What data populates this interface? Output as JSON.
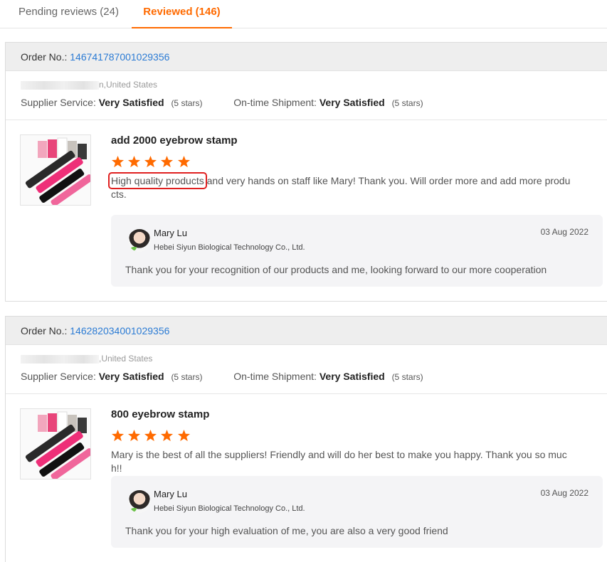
{
  "tabs": [
    {
      "label": "Pending reviews (24)"
    },
    {
      "label": "Reviewed (146)",
      "active": true
    }
  ],
  "colors": {
    "accent": "#ff6a00",
    "link": "#2b7bd4",
    "highlight_box": "#e02020"
  },
  "reviews": [
    {
      "order_label": "Order No.:",
      "order_no": "146741787001029356",
      "location": "n,United States",
      "supplier_service_label": "Supplier Service:",
      "supplier_service_value": "Very Satisfied",
      "supplier_service_stars": "(5 stars)",
      "shipment_label": "On-time Shipment:",
      "shipment_value": "Very Satisfied",
      "shipment_stars": "(5 stars)",
      "product_name": "add 2000 eyebrow stamp",
      "rating": 5,
      "comment_highlight": "High quality products",
      "comment_rest": " and very hands on staff like Mary! Thank you. Will order more and add more products.",
      "reply": {
        "name": "Mary Lu",
        "company": "Hebei Siyun Biological Technology Co., Ltd.",
        "date": "03 Aug 2022",
        "text": "Thank you for your recognition of our products and me, looking forward to our more cooperation"
      }
    },
    {
      "order_label": "Order No.:",
      "order_no": "146282034001029356",
      "location": ",United States",
      "supplier_service_label": "Supplier Service:",
      "supplier_service_value": "Very Satisfied",
      "supplier_service_stars": "(5 stars)",
      "shipment_label": "On-time Shipment:",
      "shipment_value": "Very Satisfied",
      "shipment_stars": "(5 stars)",
      "product_name": "800 eyebrow stamp",
      "rating": 5,
      "comment": "Mary is the best of all the suppliers! Friendly and will do her best to make you happy. Thank you so much!!",
      "reply": {
        "name": "Mary Lu",
        "company": "Hebei Siyun Biological Technology Co., Ltd.",
        "date": "03 Aug 2022",
        "text": "Thank you for your high evaluation of me, you are also a very good friend"
      }
    }
  ]
}
